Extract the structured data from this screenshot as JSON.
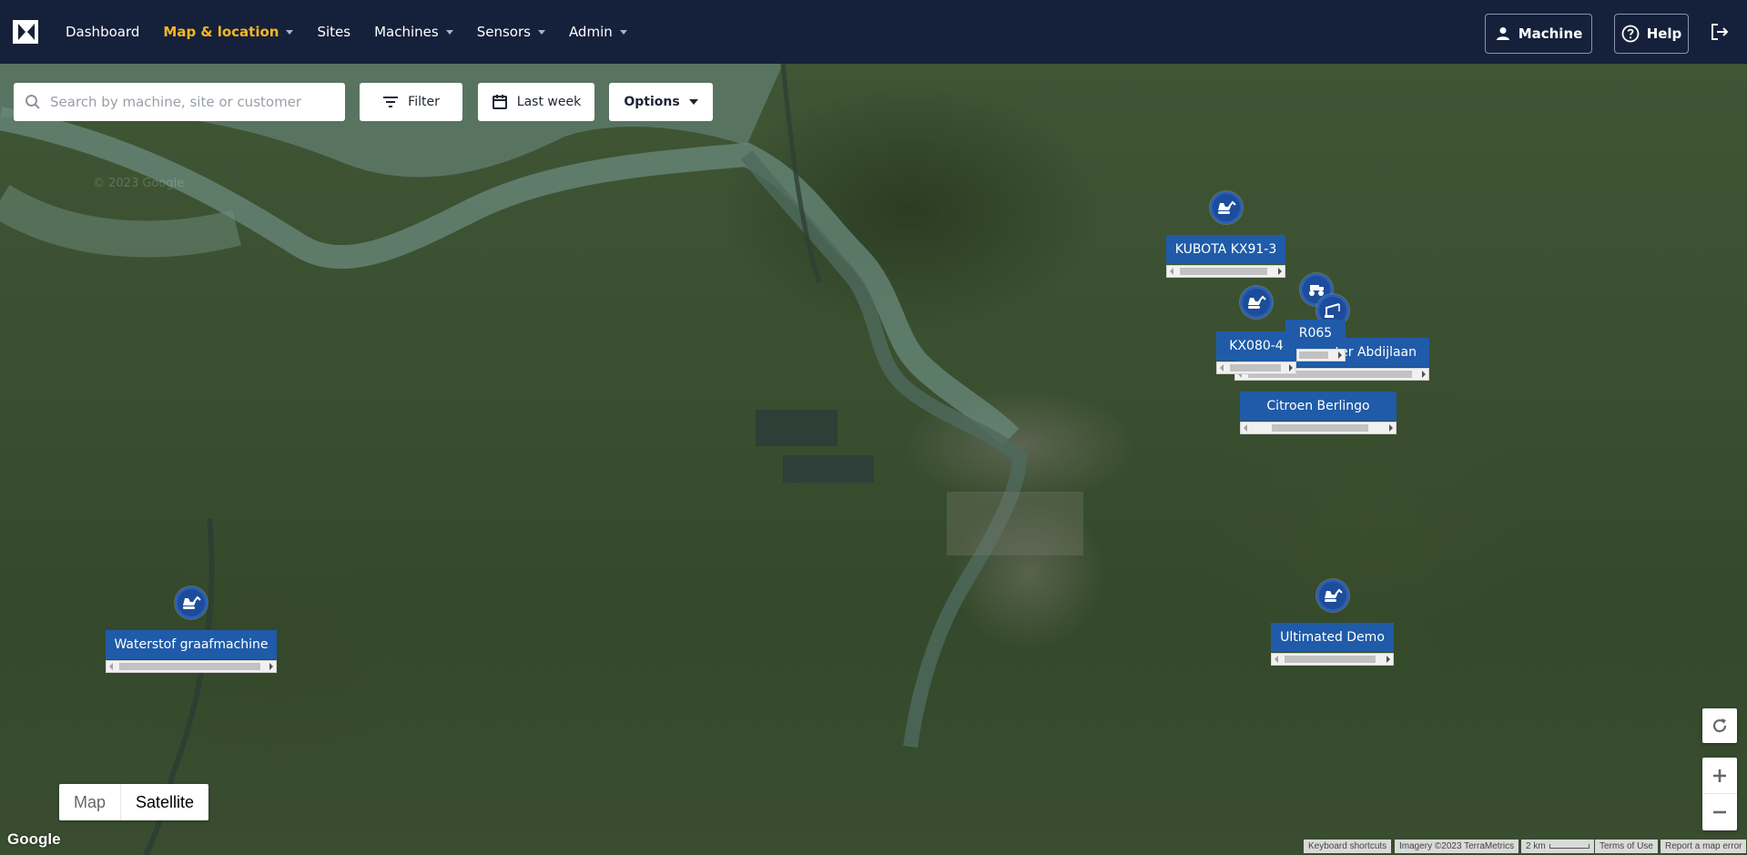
{
  "nav": {
    "items": [
      {
        "label": "Dashboard",
        "active": false,
        "dropdown": false
      },
      {
        "label": "Map & location",
        "active": true,
        "dropdown": true
      },
      {
        "label": "Sites",
        "active": false,
        "dropdown": false
      },
      {
        "label": "Machines",
        "active": false,
        "dropdown": true
      },
      {
        "label": "Sensors",
        "active": false,
        "dropdown": true
      },
      {
        "label": "Admin",
        "active": false,
        "dropdown": true
      }
    ],
    "machine_label": "Machine",
    "help_label": "Help",
    "accent_color": "#f5b623",
    "bg_color": "#15203a"
  },
  "toolbar": {
    "search_placeholder": "Search by machine, site or customer",
    "filter_label": "Filter",
    "date_label": "Last week",
    "options_label": "Options"
  },
  "markers": [
    {
      "label": "KUBOTA KX91-3",
      "icon": "excavator-icon"
    },
    {
      "label": "KX080-4",
      "icon": "excavator-icon"
    },
    {
      "label": "R065",
      "icon": "tractor-icon"
    },
    {
      "label": "ter Abdijlaan",
      "icon": "crane-icon"
    },
    {
      "label": "Citroen Berlingo",
      "icon": "truck-icon"
    },
    {
      "label": "Ultimated Demo",
      "icon": "excavator-icon"
    },
    {
      "label": "Waterstof graafmachine",
      "icon": "excavator-icon"
    }
  ],
  "map": {
    "type_map": "Map",
    "type_satellite": "Satellite",
    "selected_type": "Satellite",
    "google": "Google",
    "watermark": "© 2023 Google",
    "attribution": {
      "shortcuts": "Keyboard shortcuts",
      "imagery": "Imagery ©2023 TerraMetrics",
      "scale": "2 km",
      "terms": "Terms of Use",
      "report": "Report a map error"
    },
    "marker_color": "#1f5ba8"
  }
}
